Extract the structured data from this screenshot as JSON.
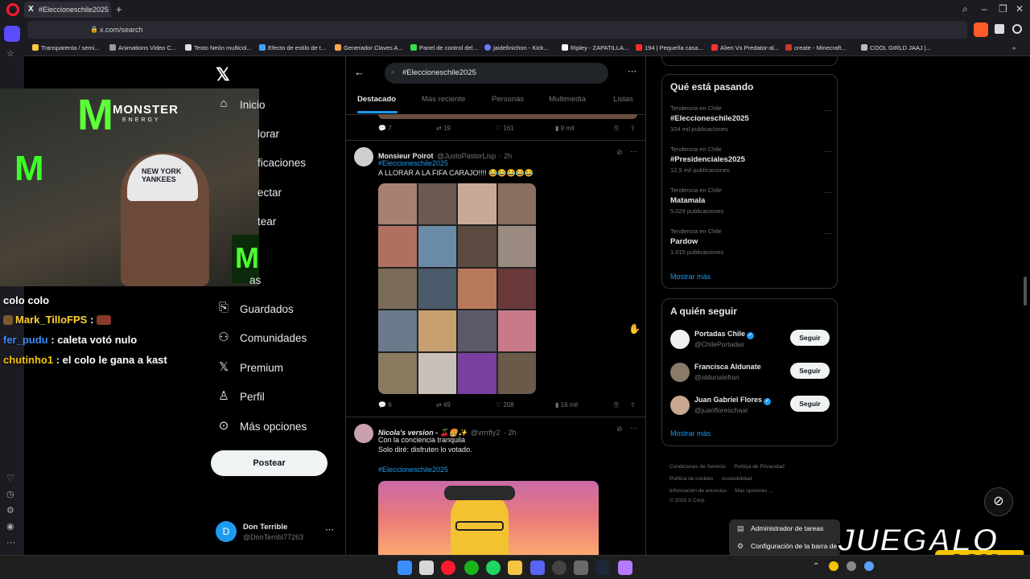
{
  "browser": {
    "tab_title": "#Eleccioneschile2025 - B...",
    "url": "x.com/search",
    "bookmarks": [
      "Transparenta / semi...",
      "Animations Video C...",
      "Texto Neón multicol...",
      "Efecto de estilo de t...",
      "Generador Claves A...",
      "Panel de control del...",
      "jaidefinichon - Kick...",
      "Ripley - ZAPATILLA...",
      "194 | Pequeña casa...",
      "Alien Vs Predator-al...",
      "create - Minecraft...",
      "COOL GIRLD JAAJ |..."
    ]
  },
  "stream": {
    "brand_text": "MONSTER",
    "brand_sub": "ENERGY",
    "cap_text": "NEW YORK YANKEES",
    "chat": [
      {
        "user": "",
        "message": "colo colo"
      },
      {
        "user": "Mark_TilloFPS",
        "message": ""
      },
      {
        "user": "fer_pudu",
        "message": "caleta votó nulo"
      },
      {
        "user": "chutinho1",
        "message": "el colo le gana a kast"
      }
    ]
  },
  "nav": {
    "items": [
      {
        "label": "Inicio",
        "icon": "home-icon"
      },
      {
        "label": "lorar",
        "icon": "search-icon"
      },
      {
        "label": "ficaciones",
        "icon": "bell-icon"
      },
      {
        "label": "ectar",
        "icon": "mail-icon"
      },
      {
        "label": "tear",
        "icon": "grok-icon"
      },
      {
        "label": "",
        "icon": "list-icon"
      },
      {
        "label": "as",
        "icon": "people-icon"
      },
      {
        "label": "Guardados",
        "icon": "bookmark-icon"
      },
      {
        "label": "Comunidades",
        "icon": "communities-icon"
      },
      {
        "label": "Premium",
        "icon": "x-icon"
      },
      {
        "label": "Perfil",
        "icon": "person-icon"
      },
      {
        "label": "Más opciones",
        "icon": "more-circle-icon"
      }
    ],
    "post_button": "Postear",
    "profile": {
      "name": "Don Terrible",
      "handle": "@DonTerribl77263",
      "initial": "D"
    }
  },
  "search": {
    "query": "#Eleccioneschile2025",
    "tabs": [
      "Destacado",
      "Más reciente",
      "Personas",
      "Multimedia",
      "Listas"
    ]
  },
  "tweets": {
    "prev_actions": {
      "replies": "7",
      "reposts": "19",
      "likes": "161",
      "views": "9 mil"
    },
    "t1": {
      "name": "Monsieur Poirot",
      "handle": "@JustoPastorLisp",
      "time": "· 2h",
      "hashtag": "#Eleccioneschile2025",
      "text": "A LLORAR A LA FIFA CARAJO!!!! 😂😂😂😂😂",
      "replies": "6",
      "reposts": "49",
      "likes": "208",
      "views": "16 mil"
    },
    "t2": {
      "name": "Nicola's version - 🍒🍔✨",
      "handle": "@vrrrfly2",
      "time": "· 2h",
      "line1": "Con la conciencia tranquila",
      "line2": "Solo diré: disfruten lo votado.",
      "hashtag": "#Eleccioneschile2025"
    }
  },
  "trends": {
    "title": "Qué está pasando",
    "items": [
      {
        "context": "Tendencia en Chile",
        "topic": "#Eleccioneschile2025",
        "count": "104 mil publicaciones"
      },
      {
        "context": "Tendencia en Chile",
        "topic": "#Presidenciales2025",
        "count": "12,9 mil publicaciones"
      },
      {
        "context": "Tendencia en Chile",
        "topic": "Matamala",
        "count": "5.029 publicaciones"
      },
      {
        "context": "Tendencia en Chile",
        "topic": "Pardow",
        "count": "1.015 publicaciones"
      }
    ],
    "show_more": "Mostrar más"
  },
  "follow": {
    "title": "A quién seguir",
    "items": [
      {
        "name": "Portadas Chile",
        "handle": "@ChilePortadas",
        "button": "Seguir",
        "verified": true
      },
      {
        "name": "Francisca Aldunate",
        "handle": "@aldunatefran",
        "button": "Seguir",
        "verified": false
      },
      {
        "name": "Juan Gabriel Flores",
        "handle": "@juanfloreschaar",
        "button": "Seguir",
        "verified": true
      }
    ],
    "show_more": "Mostrar más"
  },
  "footer": {
    "links": [
      "Condiciones de Servicio",
      "Política de Privacidad",
      "Política de cookies",
      "Accesibilidad",
      "Información de anuncios",
      "Más opciones ...",
      "© 2025 X Corp."
    ]
  },
  "tray_menu": {
    "items": [
      "Administrador de tareas",
      "Configuración de la barra de"
    ]
  },
  "watermark": {
    "main": "JUEGALO",
    "sub": ".COM"
  }
}
